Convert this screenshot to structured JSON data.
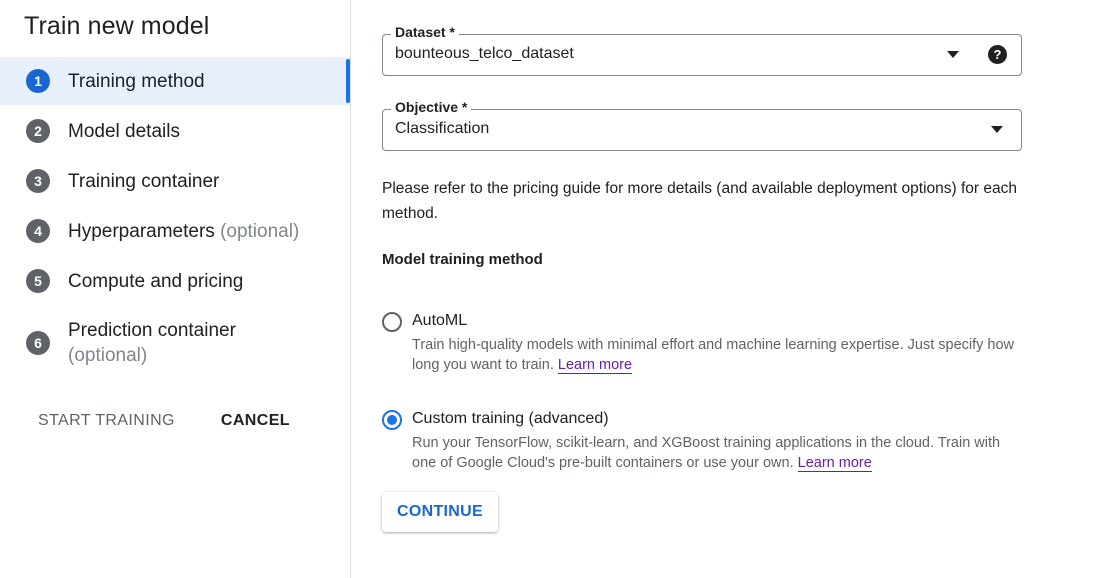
{
  "sidebar": {
    "title": "Train new model",
    "steps": [
      {
        "num": "1",
        "label": "Training method",
        "optional": "",
        "active": true
      },
      {
        "num": "2",
        "label": "Model details",
        "optional": ""
      },
      {
        "num": "3",
        "label": "Training container",
        "optional": ""
      },
      {
        "num": "4",
        "label": "Hyperparameters",
        "optional": "(optional)"
      },
      {
        "num": "5",
        "label": "Compute and pricing",
        "optional": ""
      },
      {
        "num": "6",
        "label": "Prediction container",
        "optional": "(optional)"
      }
    ],
    "start_training_label": "START TRAINING",
    "cancel_label": "CANCEL"
  },
  "form": {
    "dataset": {
      "label": "Dataset *",
      "value": "bounteous_telco_dataset",
      "help_icon": "?"
    },
    "objective": {
      "label": "Objective *",
      "value": "Classification"
    },
    "info_text": "Please refer to the pricing guide for more details (and available deployment options) for each method.",
    "section_title": "Model training method",
    "options": [
      {
        "title": "AutoML",
        "description": "Train high-quality models with minimal effort and machine learning expertise. Just specify how long you want to train.",
        "link": "Learn more",
        "checked": false
      },
      {
        "title": "Custom training (advanced)",
        "description": "Run your TensorFlow, scikit-learn, and XGBoost training applications in the cloud. Train with one of Google Cloud's pre-built containers or use your own.",
        "link": "Learn more",
        "checked": true
      }
    ],
    "continue_label": "CONTINUE"
  },
  "colors": {
    "accent": "#1a73e8",
    "active_step_bg": "#e8f0fe",
    "link": "#681da8",
    "step_inactive": "#5f6368"
  },
  "icons": {
    "dataset_dropdown": "chevron-down-icon",
    "objective_dropdown": "chevron-down-icon",
    "help": "help-circle-icon"
  }
}
